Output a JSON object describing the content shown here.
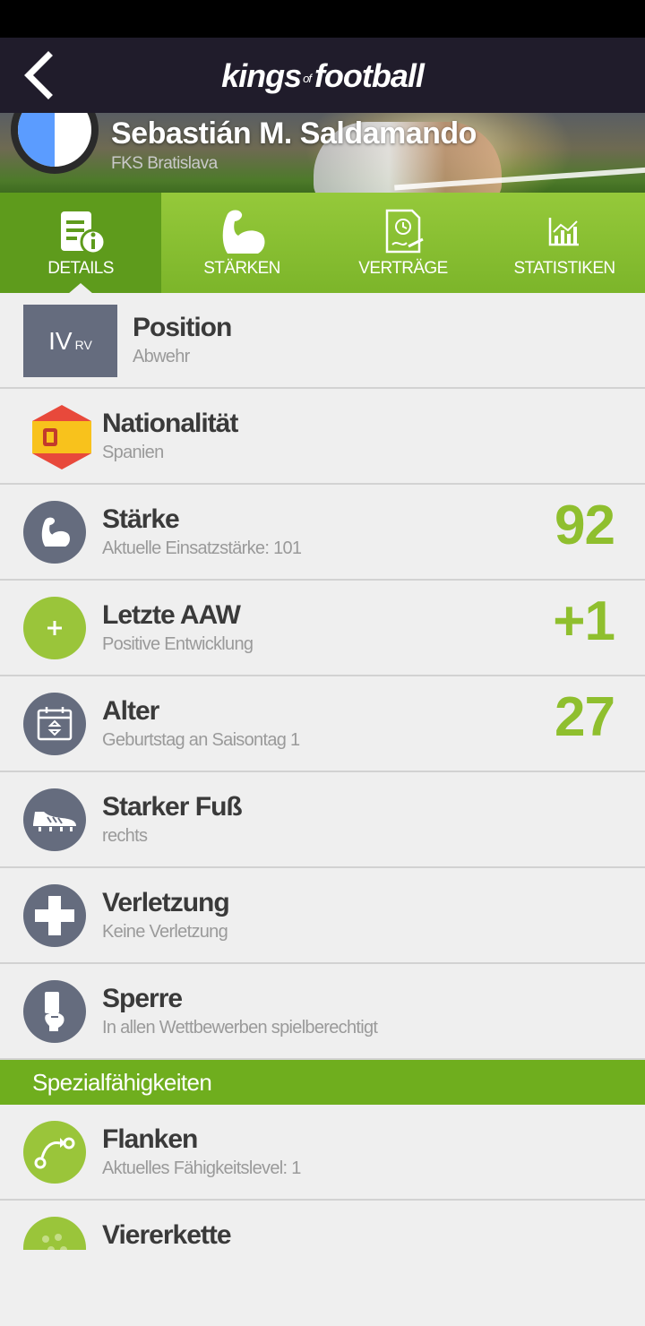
{
  "app": {
    "brand_main": "kings",
    "brand_of": "of",
    "brand_end": "football"
  },
  "player": {
    "name": "Sebastián M. Saldamando",
    "club": "FKS Bratislava"
  },
  "tabs": [
    {
      "label": "DETAILS",
      "icon": "details-icon",
      "active": true
    },
    {
      "label": "STÄRKEN",
      "icon": "bicep-icon",
      "active": false
    },
    {
      "label": "VERTRÄGE",
      "icon": "contract-icon",
      "active": false
    },
    {
      "label": "STATISTIKEN",
      "icon": "chart-icon",
      "active": false
    }
  ],
  "details": {
    "position": {
      "title": "Position",
      "sub": "Abwehr",
      "code": "IV",
      "code_small": "RV"
    },
    "nationality": {
      "title": "Nationalität",
      "sub": "Spanien"
    },
    "strength": {
      "title": "Stärke",
      "sub": "Aktuelle Einsatzstärke: 101",
      "value": "92"
    },
    "aaw": {
      "title": "Letzte AAW",
      "sub": "Positive Entwicklung",
      "value": "+1"
    },
    "age": {
      "title": "Alter",
      "sub": "Geburtstag an Saisontag 1",
      "value": "27"
    },
    "foot": {
      "title": "Starker Fuß",
      "sub": "rechts"
    },
    "injury": {
      "title": "Verletzung",
      "sub": "Keine Verletzung"
    },
    "suspension": {
      "title": "Sperre",
      "sub": "In allen Wettbewerben spielberechtigt"
    }
  },
  "special": {
    "header": "Spezialfähigkeiten",
    "items": [
      {
        "title": "Flanken",
        "sub": "Aktuelles Fähigkeitslevel: 1"
      },
      {
        "title": "Viererkette",
        "sub": ""
      }
    ]
  },
  "colors": {
    "accent": "#8fbf2e",
    "header": "#201c2b",
    "icon_gray": "#656c7e"
  }
}
